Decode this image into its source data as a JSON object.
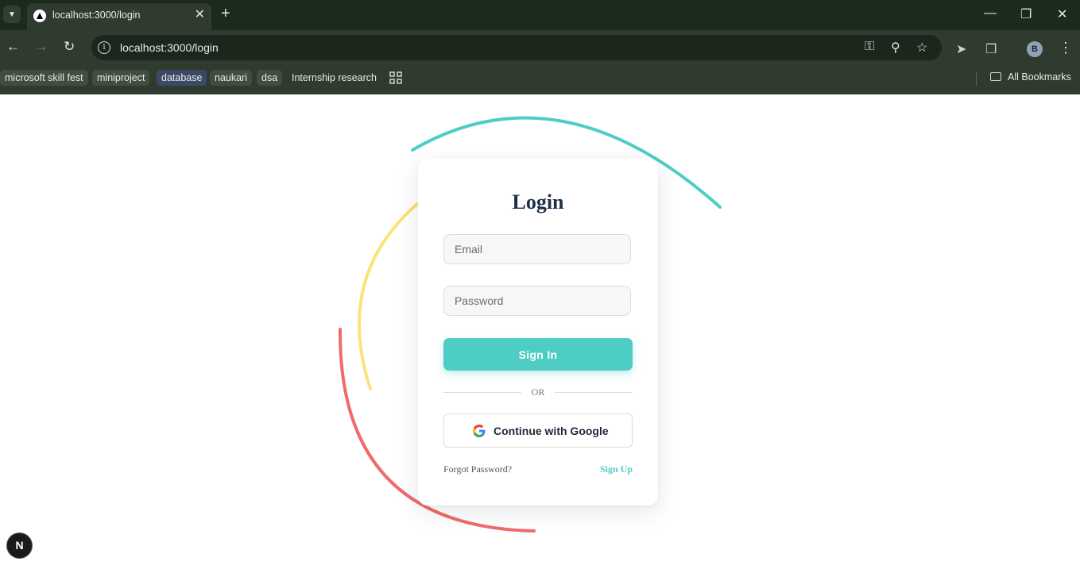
{
  "browser": {
    "tab": {
      "title": "localhost:3000/login"
    },
    "url": "localhost:3000/login",
    "bookmarks": [
      {
        "label": "microsoft skill fest"
      },
      {
        "label": "miniproject"
      },
      {
        "label": "database"
      },
      {
        "label": "naukari"
      },
      {
        "label": "dsa"
      },
      {
        "label": "Internship research"
      }
    ],
    "all_bookmarks": "All Bookmarks",
    "profile_initial": "B"
  },
  "login": {
    "title": "Login",
    "email_placeholder": "Email",
    "password_placeholder": "Password",
    "signin_label": "Sign In",
    "or_text": "OR",
    "google_label": "Continue with Google",
    "forgot_label": "Forgot Password?",
    "signup_label": "Sign Up"
  },
  "dev_badge": "N",
  "colors": {
    "accent": "#4ecdc4",
    "arc_teal": "#4ecdc4",
    "arc_yellow": "#fbe37a",
    "arc_red": "#f16b6b",
    "title": "#1e2f45"
  }
}
